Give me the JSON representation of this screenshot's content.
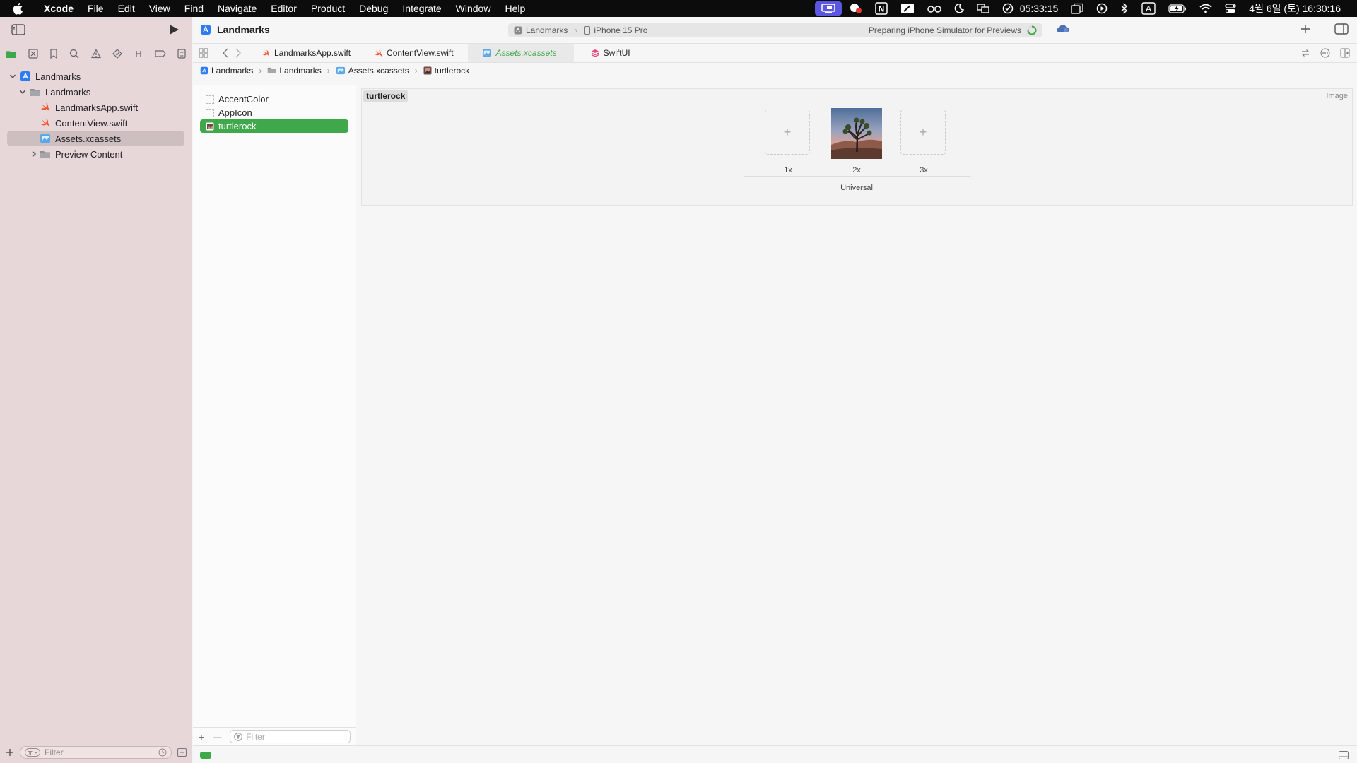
{
  "menubar": {
    "app_name": "Xcode",
    "items": [
      "File",
      "Edit",
      "View",
      "Find",
      "Navigate",
      "Editor",
      "Product",
      "Debug",
      "Integrate",
      "Window",
      "Help"
    ],
    "timer": "05:33:15",
    "clock": "4월 6일 (토) 16:30:16",
    "input_indicator": "A",
    "notion_letter": "N"
  },
  "toolbar": {
    "project_title": "Landmarks",
    "scheme_target": "Landmarks",
    "scheme_device": "iPhone 15 Pro",
    "activity_status": "Preparing iPhone Simulator for Previews"
  },
  "navigator": {
    "tree": [
      {
        "label": "Landmarks",
        "level": 0,
        "kind": "project",
        "expanded": true
      },
      {
        "label": "Landmarks",
        "level": 1,
        "kind": "folder",
        "expanded": true
      },
      {
        "label": "LandmarksApp.swift",
        "level": 2,
        "kind": "swift"
      },
      {
        "label": "ContentView.swift",
        "level": 2,
        "kind": "swift"
      },
      {
        "label": "Assets.xcassets",
        "level": 2,
        "kind": "assets",
        "selected": true
      },
      {
        "label": "Preview Content",
        "level": 2,
        "kind": "folder",
        "expanded": false
      }
    ],
    "filter_placeholder": "Filter"
  },
  "tabs": [
    {
      "label": "LandmarksApp.swift",
      "kind": "swift",
      "active": false
    },
    {
      "label": "ContentView.swift",
      "kind": "swift",
      "active": false
    },
    {
      "label": "Assets.xcassets",
      "kind": "assets",
      "active": true
    },
    {
      "label": "SwiftUI",
      "kind": "swiftui",
      "active": false
    }
  ],
  "jumpbar": [
    "Landmarks",
    "Landmarks",
    "Assets.xcassets",
    "turtlerock"
  ],
  "asset_list": {
    "items": [
      {
        "label": "AccentColor",
        "selected": false
      },
      {
        "label": "AppIcon",
        "selected": false
      },
      {
        "label": "turtlerock",
        "selected": true
      }
    ],
    "filter_placeholder": "Filter",
    "add_symbol": "+",
    "remove_symbol": "—"
  },
  "asset_detail": {
    "name": "turtlerock",
    "type_label": "Image",
    "slots": [
      {
        "scale": "1x",
        "filled": false
      },
      {
        "scale": "2x",
        "filled": true
      },
      {
        "scale": "3x",
        "filled": false
      }
    ],
    "slot_add_symbol": "+",
    "group_label": "Universal"
  },
  "colors": {
    "accent_green": "#3fa84b",
    "sidebar_bg": "#e8d7d8",
    "menubar_bg": "#0c0c0c",
    "swift_orange": "#f0582f"
  }
}
